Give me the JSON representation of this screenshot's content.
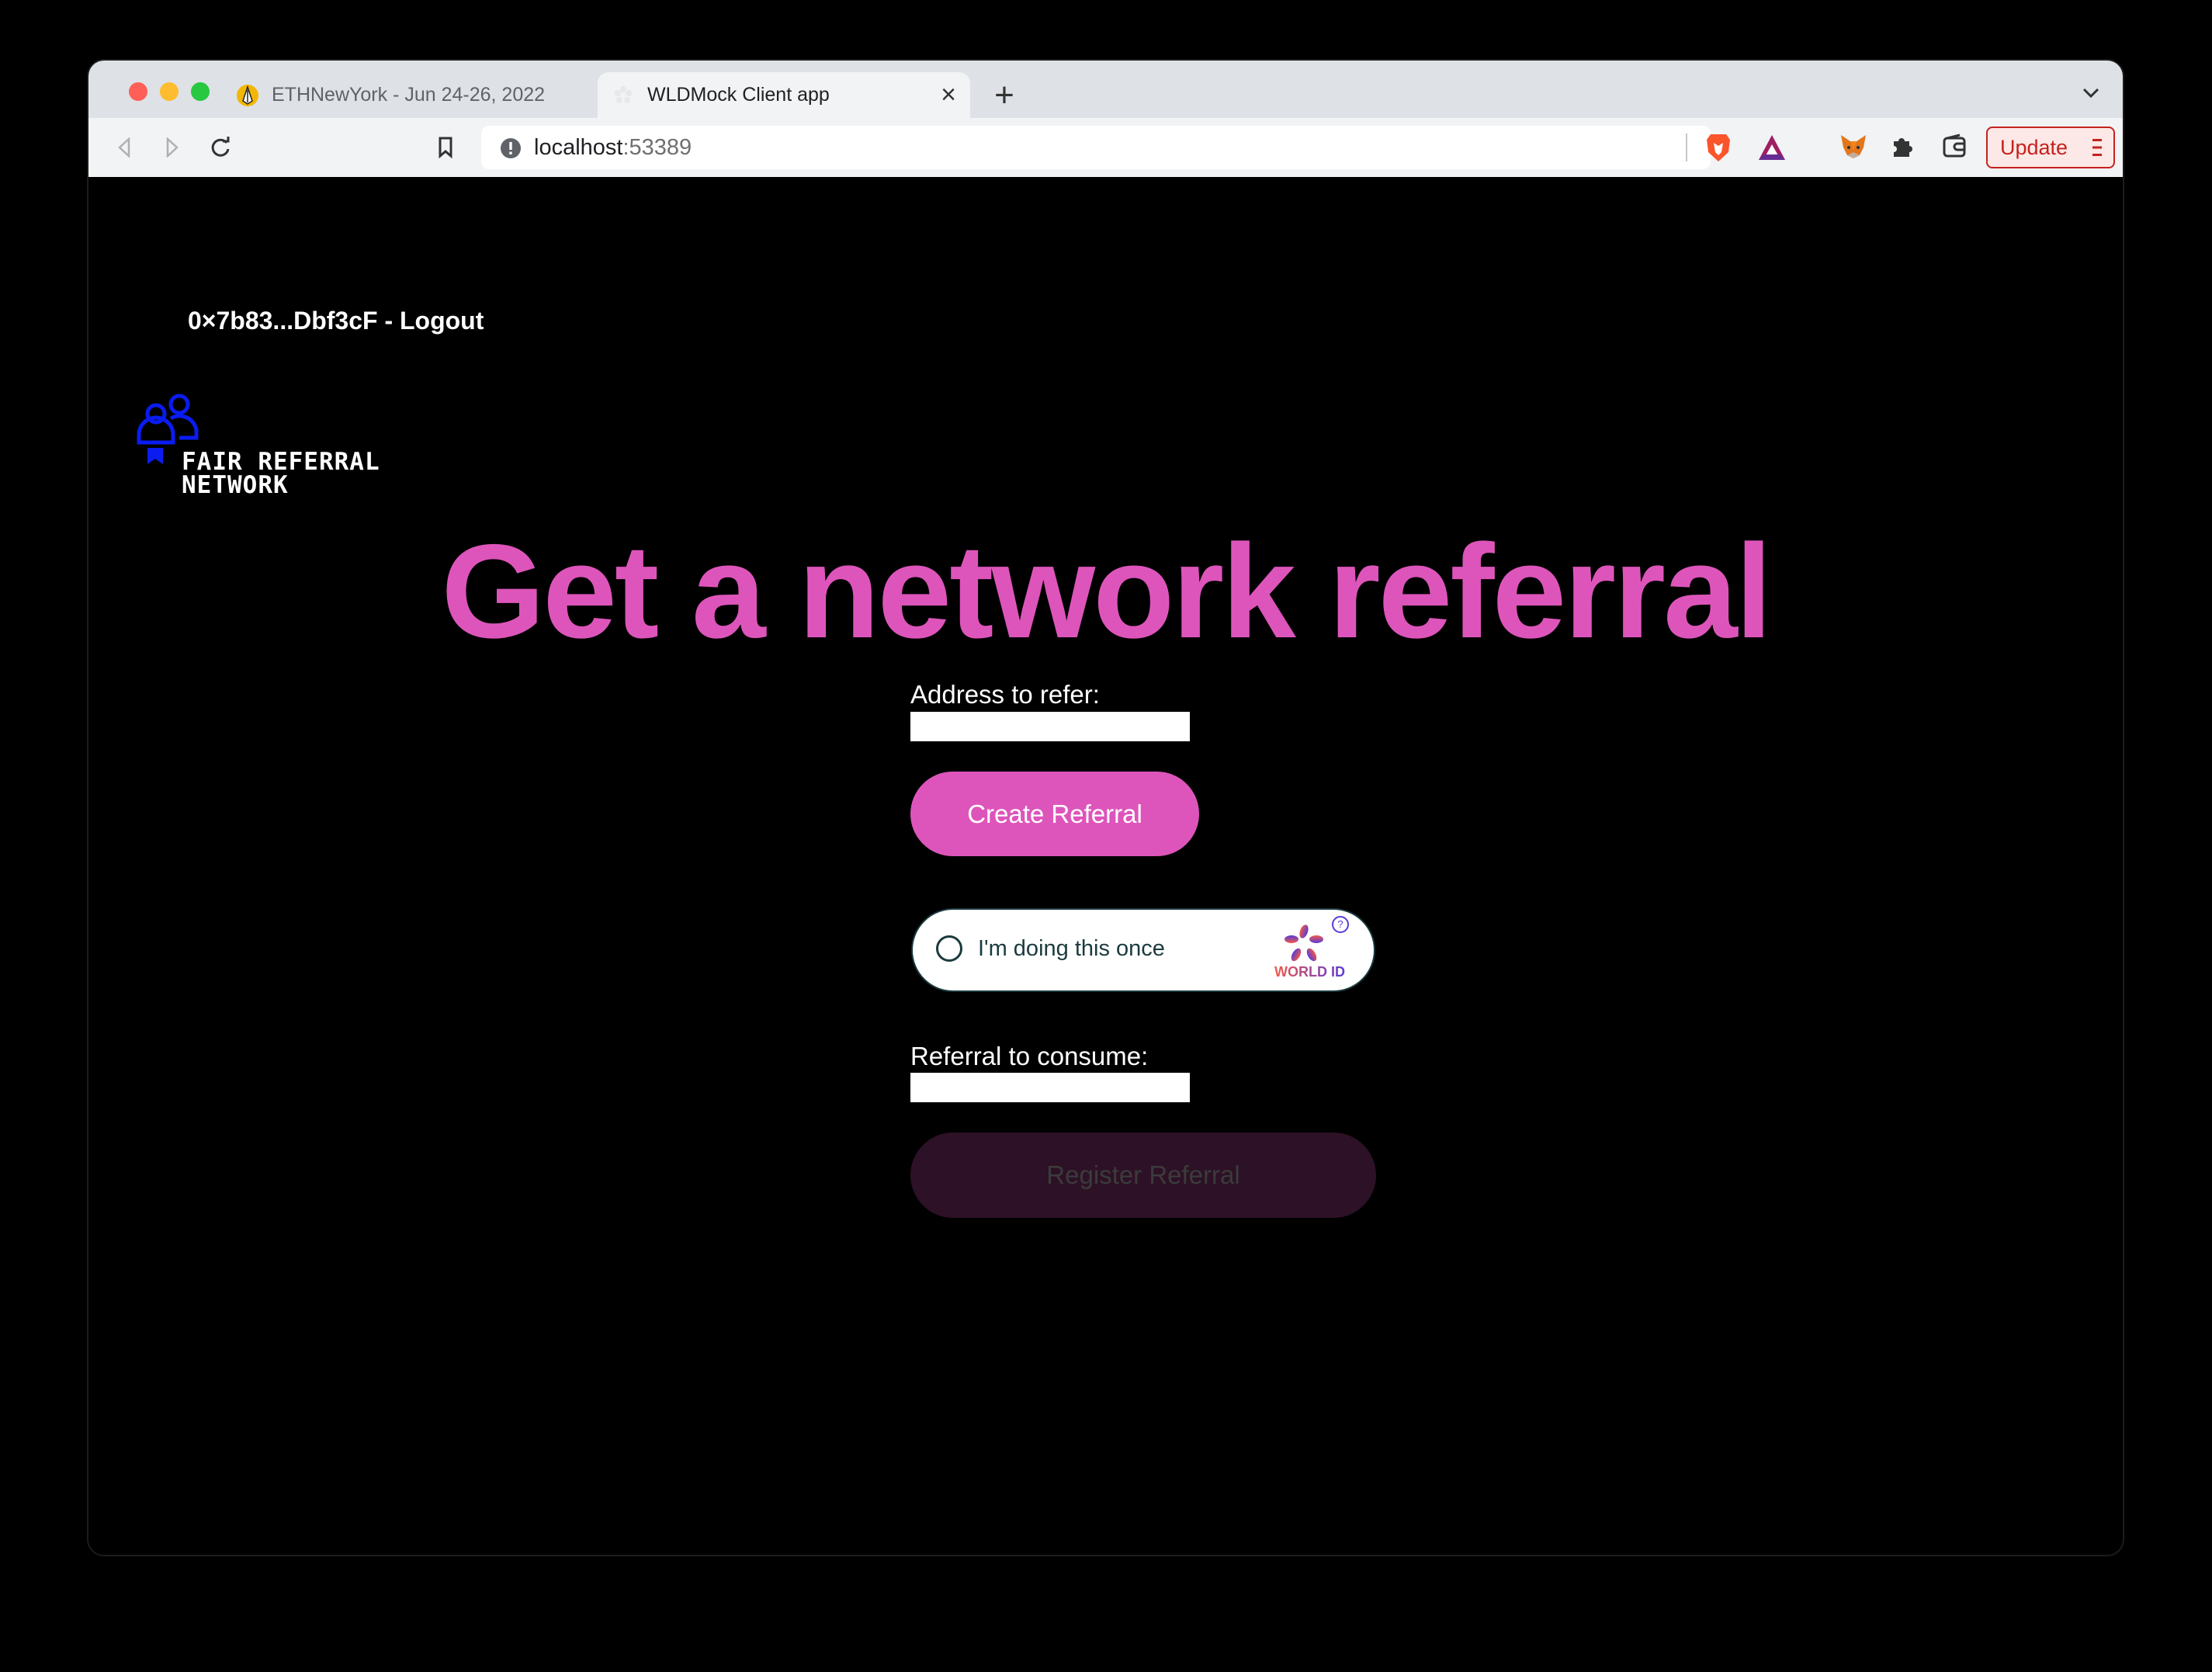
{
  "browser": {
    "tabs": [
      {
        "label": "ETHNewYork - Jun 24-26, 2022",
        "icon": "ethnewyork-favicon",
        "active": false
      },
      {
        "label": "WLDMock Client app",
        "icon": "worldcoin-favicon",
        "active": true
      }
    ],
    "close_tab_glyph": "×",
    "new_tab_glyph": "+",
    "tab_list_glyph": "⌄",
    "address": {
      "host": "localhost",
      "port": ":53389"
    },
    "update_label": "Update"
  },
  "page": {
    "account": "0×7b83...Dbf3cF - Logout",
    "logo": {
      "line1": "FAIR REFERRAL",
      "line2": "NETWORK"
    },
    "heading": "Get a network referral",
    "address_label": "Address to refer:",
    "address_value": "",
    "create_button": "Create Referral",
    "worldid": {
      "label": "I'm doing this once",
      "brand": "WORLD ID",
      "help_glyph": "?"
    },
    "consume_label": "Referral to consume:",
    "consume_value": "",
    "register_button": "Register Referral"
  },
  "colors": {
    "accent": "#dd55bb",
    "disabled_button": "#2d1126",
    "disabled_text": "#3b3b3b",
    "logo_blue": "#0a1cf0",
    "update_red": "#c5221f"
  }
}
